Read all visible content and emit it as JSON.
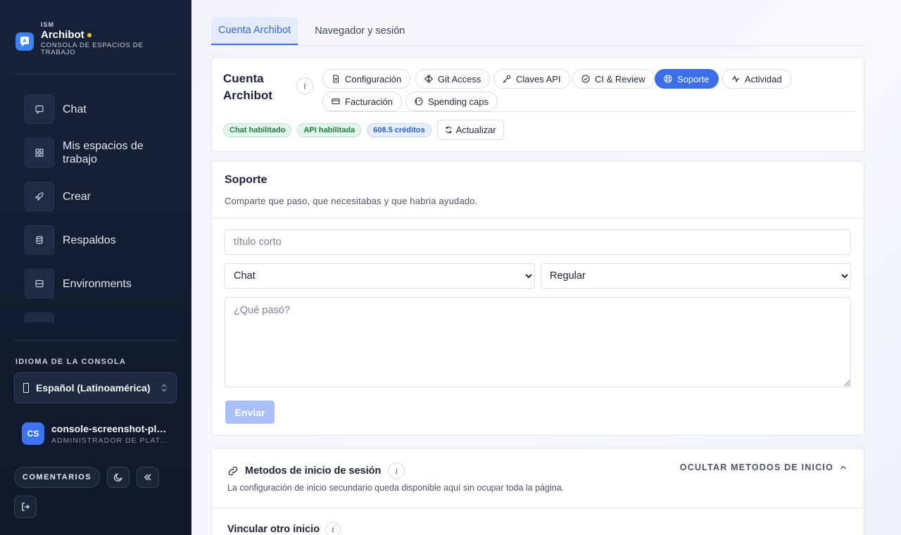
{
  "brand": {
    "org": "ISM",
    "name": "Archibot",
    "subtitle": "CONSOLA DE ESPACIOS DE TRABAJO",
    "dot_color": "#f5c518"
  },
  "sidebar": {
    "items": [
      {
        "label": "Chat",
        "icon": "chat-icon"
      },
      {
        "label": "Mis espacios de trabajo",
        "icon": "grid-icon"
      },
      {
        "label": "Crear",
        "icon": "rocket-icon"
      },
      {
        "label": "Respaldos",
        "icon": "database-icon"
      },
      {
        "label": "Environments",
        "icon": "server-icon"
      }
    ],
    "language_label": "IDIOMA DE LA CONSOLA",
    "language_value": "Español (Latinoamérica)",
    "user": {
      "initials": "CS",
      "name": "console-screenshot-platform-admin",
      "role": "ADMINISTRADOR DE PLATAFORMA"
    },
    "comments_label": "COMENTARIOS"
  },
  "main": {
    "tabs": [
      {
        "label": "Cuenta Archibot",
        "active": true
      },
      {
        "label": "Navegador y sesión",
        "active": false
      }
    ],
    "account": {
      "title": "Cuenta Archibot",
      "info": "i",
      "pills": [
        {
          "label": "Configuración",
          "icon": "file-icon"
        },
        {
          "label": "Git Access",
          "icon": "git-icon"
        },
        {
          "label": "Claves API",
          "icon": "key-icon"
        },
        {
          "label": "CI & Review",
          "icon": "check-circle-icon"
        },
        {
          "label": "Soporte",
          "icon": "lifebuoy-icon",
          "active": true
        },
        {
          "label": "Actividad",
          "icon": "activity-icon"
        },
        {
          "label": "Facturación",
          "icon": "card-icon"
        },
        {
          "label": "Spending caps",
          "icon": "gauge-icon"
        }
      ],
      "badges": {
        "chat": "Chat habilitado",
        "api": "API habilitada",
        "credits": "608.5 créditos"
      },
      "refresh_label": "Actualizar"
    },
    "support": {
      "title": "Soporte",
      "description": "Comparte que paso, que necesitabas y que habria ayudado.",
      "title_placeholder": "título corto",
      "area_value": "Chat",
      "severity_value": "Regular",
      "description_placeholder": "¿Qué pasó?",
      "send_label": "Enviar"
    },
    "login_methods": {
      "title": "Metodos de inicio de sesión",
      "info": "i",
      "hide_label": "OCULTAR METODOS DE INICIO",
      "description": "La configuración de inicio secundario queda disponible aquí sin ocupar toda la página.",
      "link_other_title": "Vincular otro inicio"
    }
  },
  "colors": {
    "accent": "#3b6fe8",
    "sidebar_bg": "#17233a",
    "send_disabled": "#a8c0f7"
  }
}
